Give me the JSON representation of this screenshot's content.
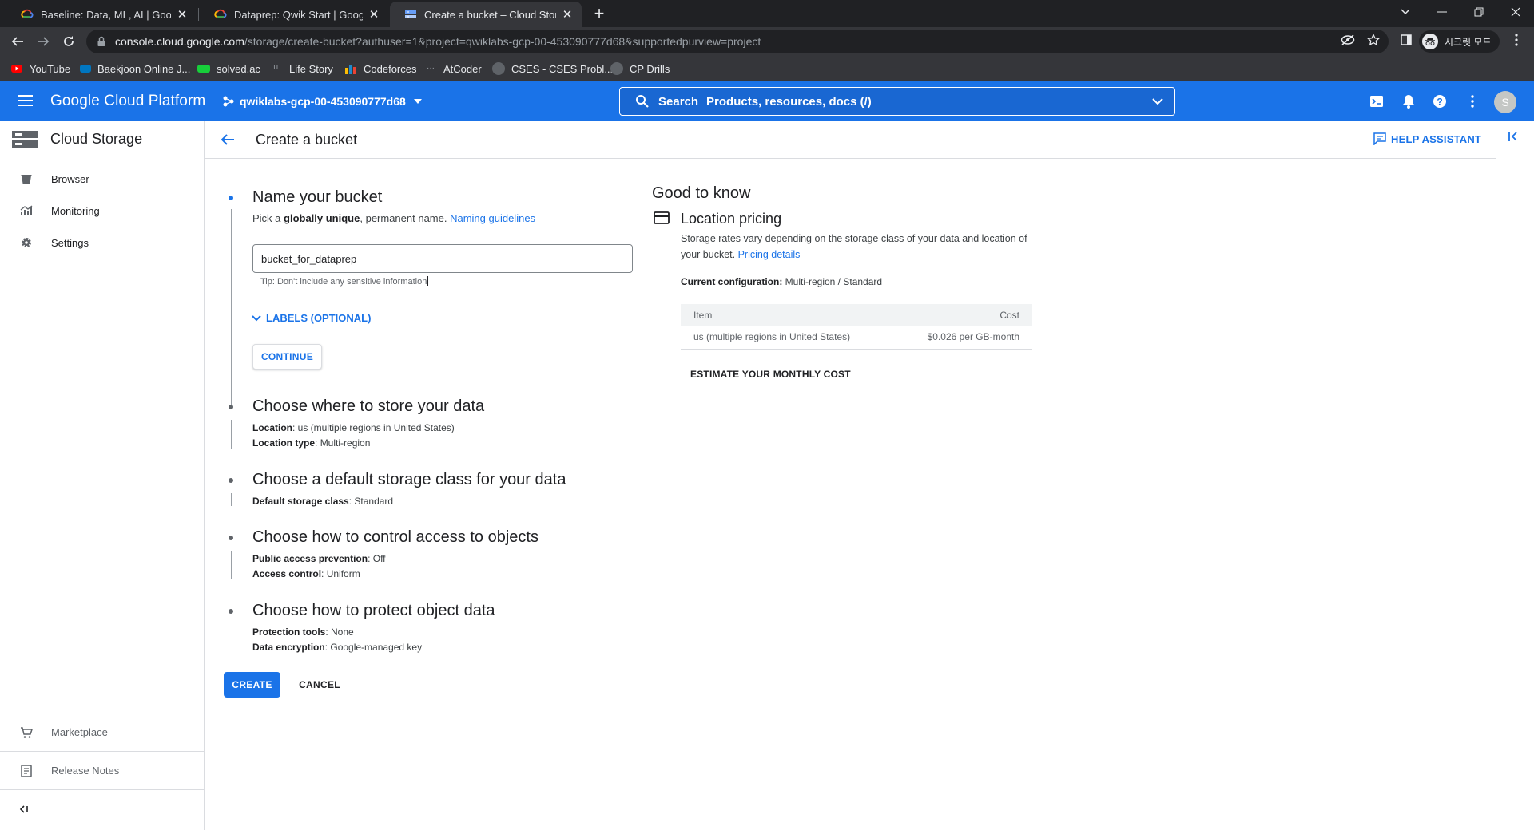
{
  "browser": {
    "tabs": [
      {
        "title": "Baseline: Data, ML, AI | Google",
        "favicon": "gcp-logo-icon",
        "active": false
      },
      {
        "title": "Dataprep: Qwik Start | Google C",
        "favicon": "gcp-logo-icon",
        "active": false
      },
      {
        "title": "Create a bucket – Cloud Storage",
        "favicon": "storage-icon",
        "active": true
      }
    ],
    "url_host": "console.cloud.google.com",
    "url_path": "/storage/create-bucket?authuser=1&project=qwiklabs-gcp-00-453090777d68&supportedpurview=project",
    "profile_label": "시크릿 모드",
    "bookmarks": [
      {
        "label": "YouTube",
        "icon": "youtube-icon",
        "color": "#ff0000"
      },
      {
        "label": "Baekjoon Online J...",
        "icon": "boj-icon",
        "color": "#0076c0"
      },
      {
        "label": "solved.ac",
        "icon": "solvedac-icon",
        "color": "#17ce3a"
      },
      {
        "label": "Life Story",
        "icon": "lifestory-icon",
        "color": "#9aa0a6"
      },
      {
        "label": "Codeforces",
        "icon": "codeforces-icon",
        "color": "#1f8acb"
      },
      {
        "label": "AtCoder",
        "icon": "atcoder-icon",
        "color": "#5f6368"
      },
      {
        "label": "CSES - CSES Probl...",
        "icon": "cses-icon",
        "color": "#9aa0a6"
      },
      {
        "label": "CP Drills",
        "icon": "cpdrills-icon",
        "color": "#9aa0a6"
      }
    ]
  },
  "header": {
    "brand": "Google Cloud Platform",
    "project": "qwiklabs-gcp-00-453090777d68",
    "search_label": "Search",
    "search_placeholder": "Products, resources, docs (/)",
    "avatar_letter": "S",
    "accent_color": "#1a73e8"
  },
  "sidebar": {
    "product": "Cloud Storage",
    "items": [
      {
        "label": "Browser",
        "icon": "bucket-icon"
      },
      {
        "label": "Monitoring",
        "icon": "monitoring-icon"
      },
      {
        "label": "Settings",
        "icon": "gear-icon"
      }
    ],
    "bottom_items": [
      {
        "label": "Marketplace",
        "icon": "cart-icon"
      },
      {
        "label": "Release Notes",
        "icon": "release-notes-icon"
      }
    ]
  },
  "page": {
    "title": "Create a bucket",
    "help_assistant": "HELP ASSISTANT"
  },
  "steps": {
    "name": {
      "title": "Name your bucket",
      "sub_prefix": "Pick a ",
      "sub_bold": "globally unique",
      "sub_suffix": ", permanent name. ",
      "sub_link": "Naming guidelines",
      "input_value": "bucket_for_dataprep",
      "tip": "Tip: Don't include any sensitive information",
      "labels_toggle": "LABELS (OPTIONAL)",
      "continue": "CONTINUE"
    },
    "location": {
      "title": "Choose where to store your data",
      "lines": [
        {
          "key": "Location",
          "value": "us (multiple regions in United States)"
        },
        {
          "key": "Location type",
          "value": "Multi-region"
        }
      ]
    },
    "storage_class": {
      "title": "Choose a default storage class for your data",
      "lines": [
        {
          "key": "Default storage class",
          "value": "Standard"
        }
      ]
    },
    "access": {
      "title": "Choose how to control access to objects",
      "lines": [
        {
          "key": "Public access prevention",
          "value": "Off"
        },
        {
          "key": "Access control",
          "value": "Uniform"
        }
      ]
    },
    "protect": {
      "title": "Choose how to protect object data",
      "lines": [
        {
          "key": "Protection tools",
          "value": "None"
        },
        {
          "key": "Data encryption",
          "value": "Google-managed key"
        }
      ]
    }
  },
  "actions": {
    "create": "CREATE",
    "cancel": "CANCEL"
  },
  "good_to_know": {
    "title": "Good to know",
    "pricing_title": "Location pricing",
    "pricing_desc": "Storage rates vary depending on the storage class of your data and location of your bucket. ",
    "pricing_link": "Pricing details",
    "config_label": "Current configuration:",
    "config_value": " Multi-region / Standard",
    "table": {
      "headers": [
        "Item",
        "Cost"
      ],
      "rows": [
        [
          "us (multiple regions in United States)",
          "$0.026 per GB-month"
        ]
      ]
    },
    "estimate": "ESTIMATE YOUR MONTHLY COST"
  }
}
